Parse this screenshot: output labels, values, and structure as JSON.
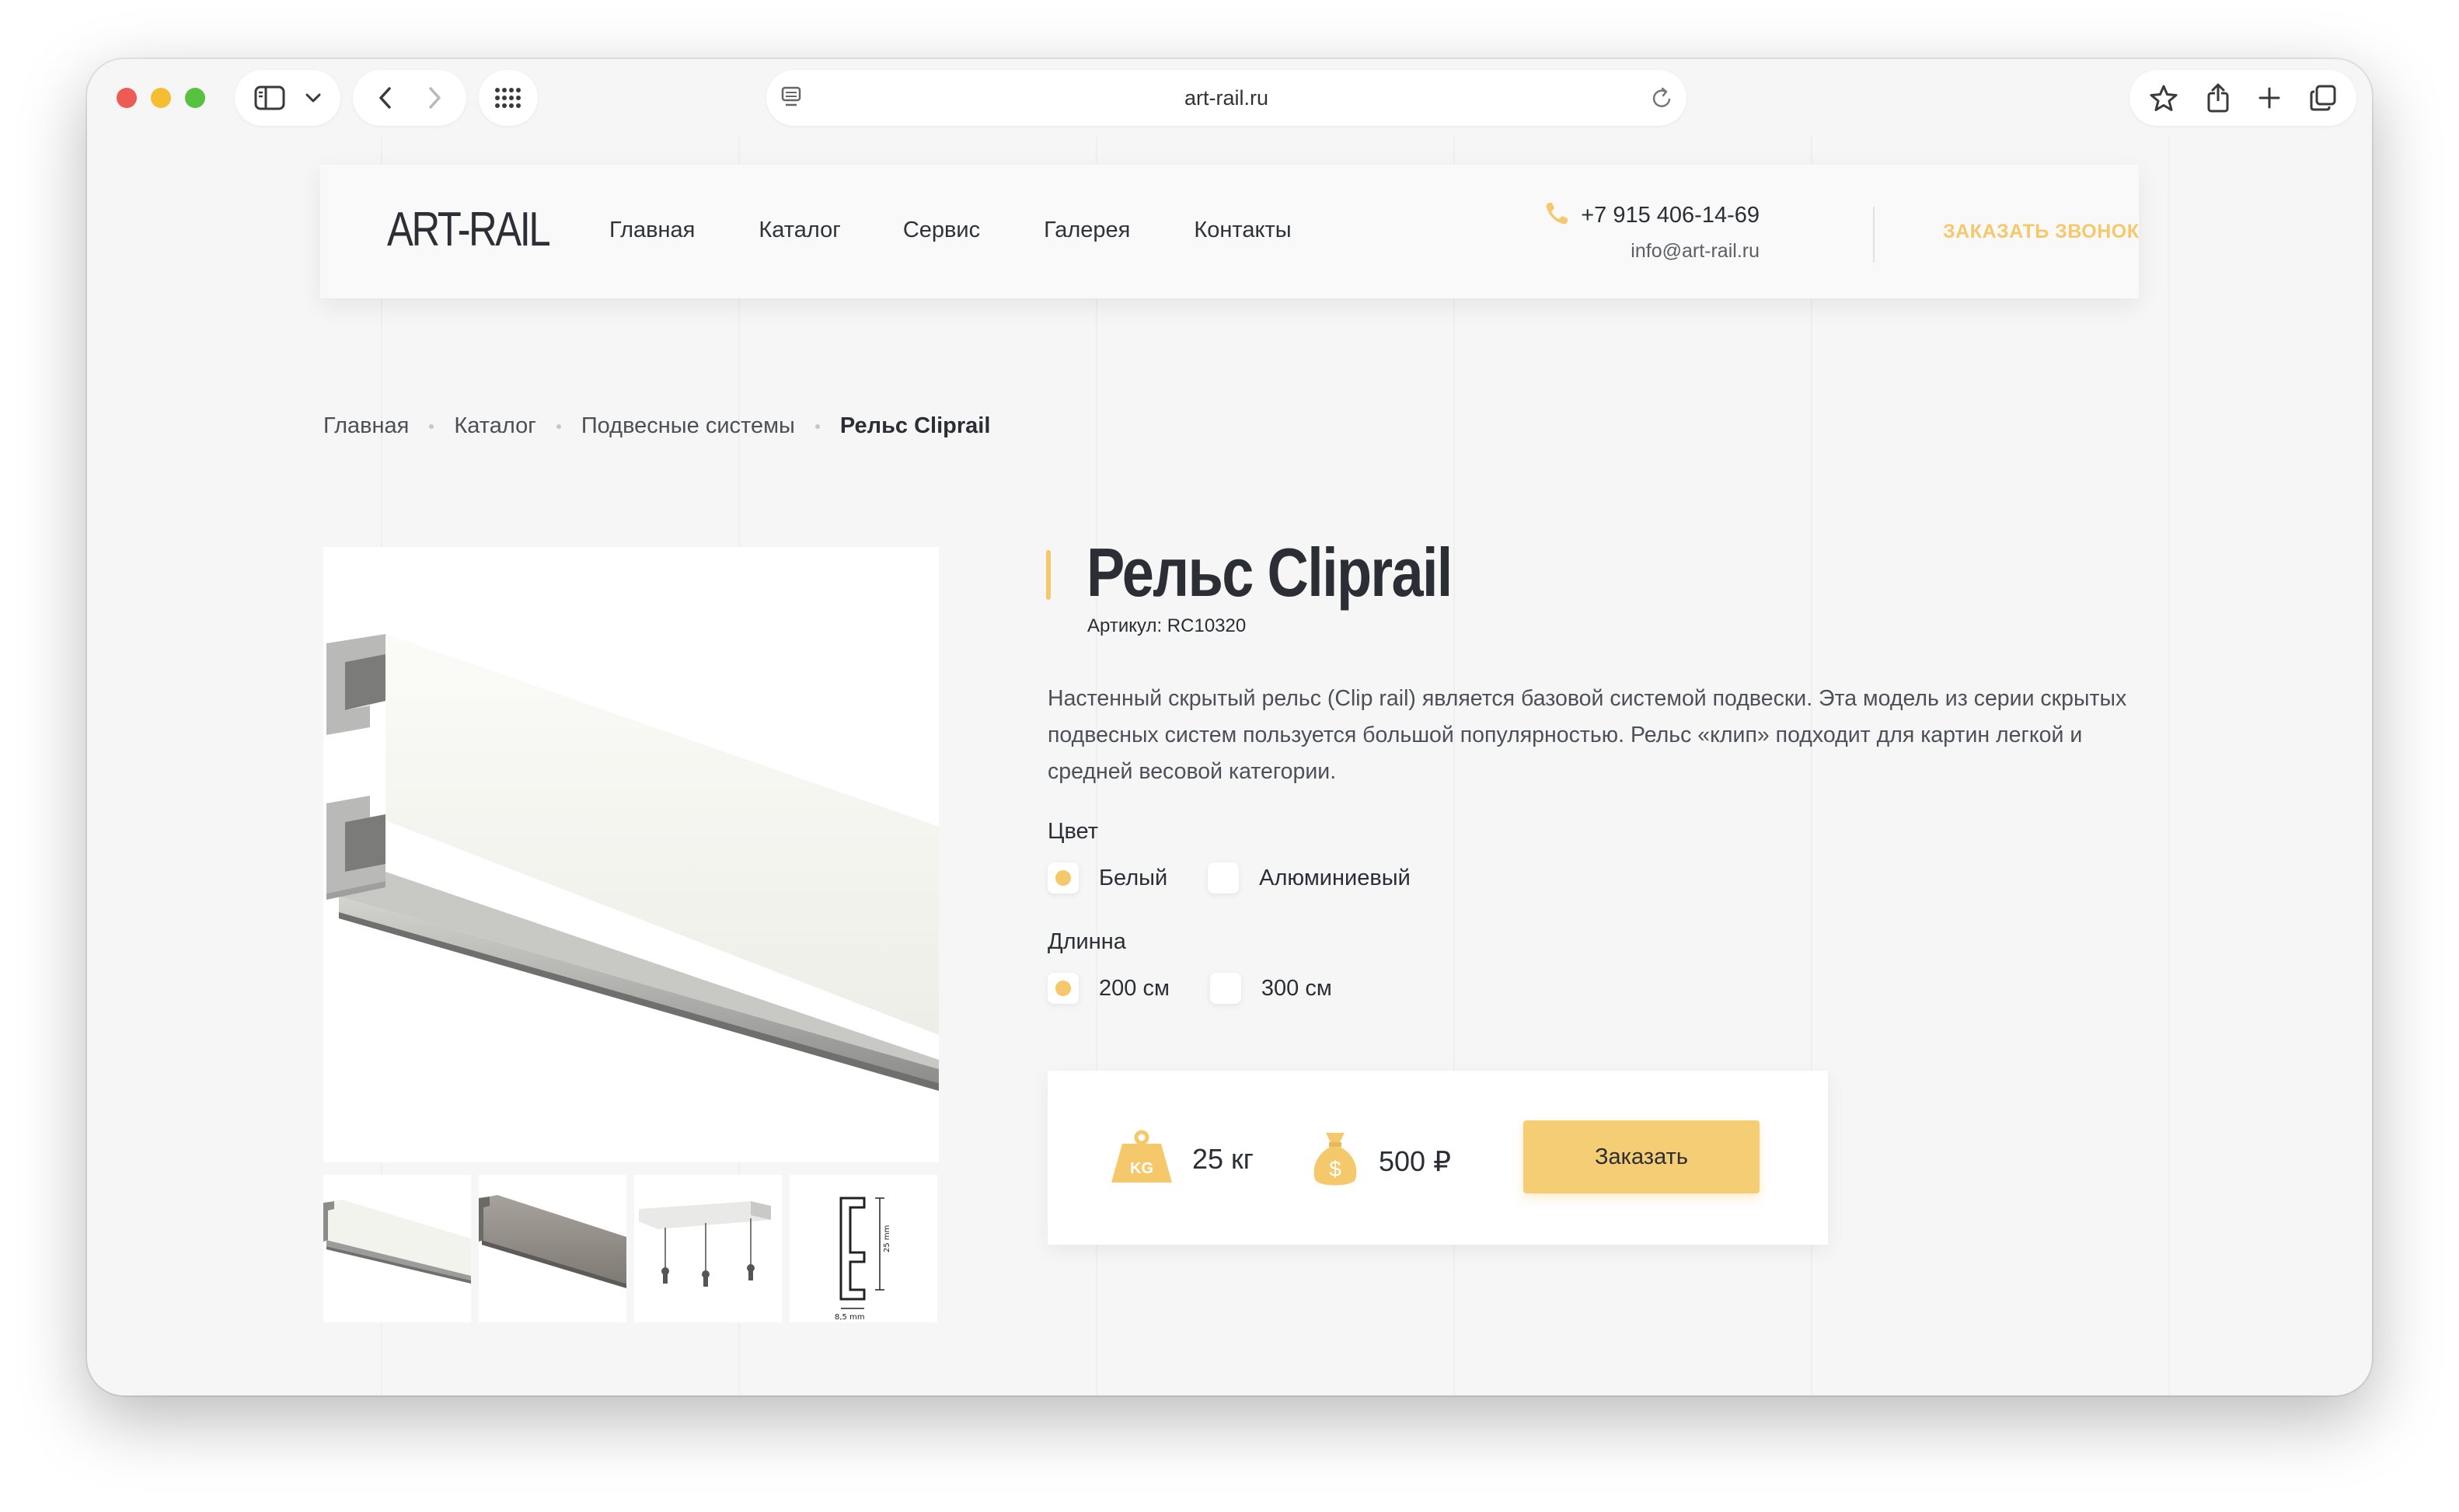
{
  "browser": {
    "url": "art-rail.ru"
  },
  "header": {
    "logo": "ART-RAIL",
    "nav": [
      "Главная",
      "Каталог",
      "Сервис",
      "Галерея",
      "Контакты"
    ],
    "phone": "+7 915 406-14-69",
    "email": "info@art-rail.ru",
    "callback_label": "ЗАКАЗАТЬ ЗВОНОК"
  },
  "breadcrumb": [
    "Главная",
    "Каталог",
    "Подвесные системы",
    "Рельс Cliprail"
  ],
  "product": {
    "title": "Рельс Cliprail",
    "sku": "Артикул: RC10320",
    "description": "Настенный скрытый рельс (Clip rail) является базовой системой подвески. Эта модель из серии скрытых подвесных систем пользуется большой популярностью. Рельс «клип» подходит для картин легкой и средней весовой категории.",
    "color_label": "Цвет",
    "colors": [
      {
        "label": "Белый",
        "selected": true
      },
      {
        "label": "Алюминиевый",
        "selected": false
      }
    ],
    "length_label": "Длинна",
    "lengths": [
      {
        "label": "200 см",
        "selected": true
      },
      {
        "label": "300 см",
        "selected": false
      }
    ],
    "weight": "25 кг",
    "price": "500 ₽",
    "order_label": "Заказать",
    "weight_icon_text": "KG",
    "price_icon_text": "$",
    "drawing_height_label": "25 mm",
    "drawing_width_label": "8,5 mm"
  },
  "theme": {
    "accent": "#f5c96b",
    "text": "#2b2e35",
    "background": "#f6f6f6"
  }
}
